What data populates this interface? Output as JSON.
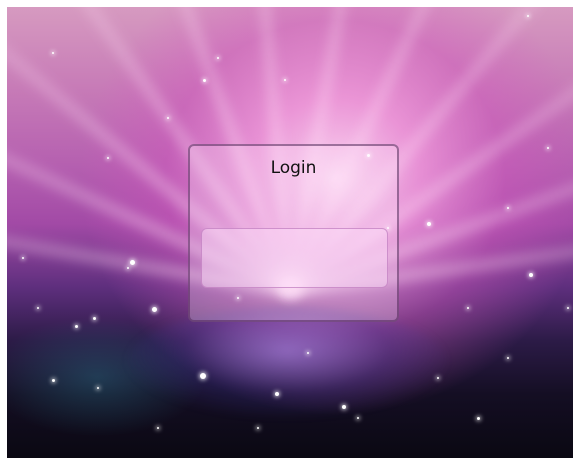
{
  "login": {
    "title": "Login",
    "field_value": ""
  },
  "colors": {
    "panel_border": "#5a2e66",
    "field_border": "#be78be"
  },
  "icons": {
    "background": "aurora-wallpaper"
  }
}
